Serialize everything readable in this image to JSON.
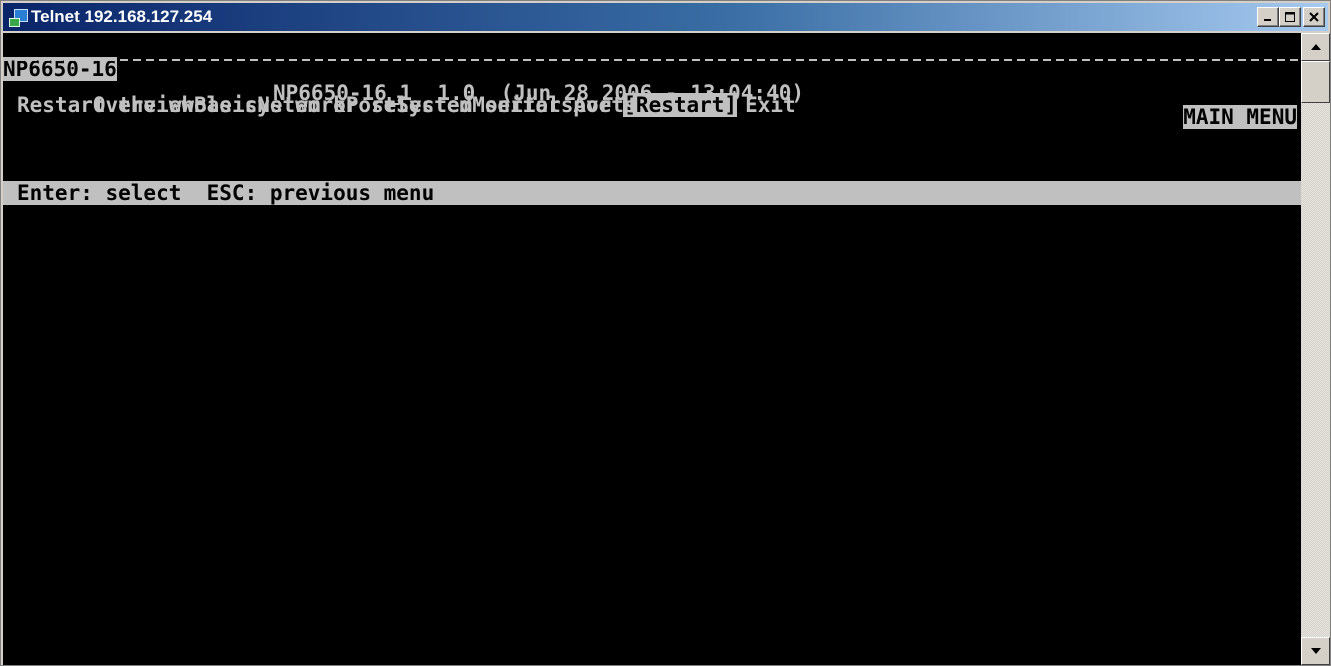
{
  "window": {
    "title": "Telnet 192.168.127.254",
    "controls": {
      "minimize_icon": "minimize-icon",
      "maximize_icon": "maximize-icon",
      "close_icon": "close-icon"
    }
  },
  "terminal": {
    "header": {
      "device": "NP6650-16",
      "firmware": "NP6650-16_1  1.0  (Jun 28 2006 - 13:04:40)",
      "menu_name": "MAIN MENU"
    },
    "menu": {
      "items": [
        {
          "label": "Overview",
          "selected": false
        },
        {
          "label": "Basic",
          "selected": false
        },
        {
          "label": "Network",
          "selected": false
        },
        {
          "label": "Port",
          "selected": false
        },
        {
          "label": "System",
          "selected": false
        },
        {
          "label": "Monitor",
          "selected": false
        },
        {
          "label": "sAve",
          "selected": false
        },
        {
          "label": "[Restart]",
          "selected": true
        },
        {
          "label": "Exit",
          "selected": false
        }
      ],
      "description": "Restart the whole system or selected serial ports"
    },
    "status_bar": "Enter: select  ESC: previous menu"
  },
  "colors": {
    "terminal_bg": "#000000",
    "terminal_fg": "#c0c0c0",
    "titlebar_start": "#0a246a",
    "titlebar_end": "#a6caf0"
  }
}
